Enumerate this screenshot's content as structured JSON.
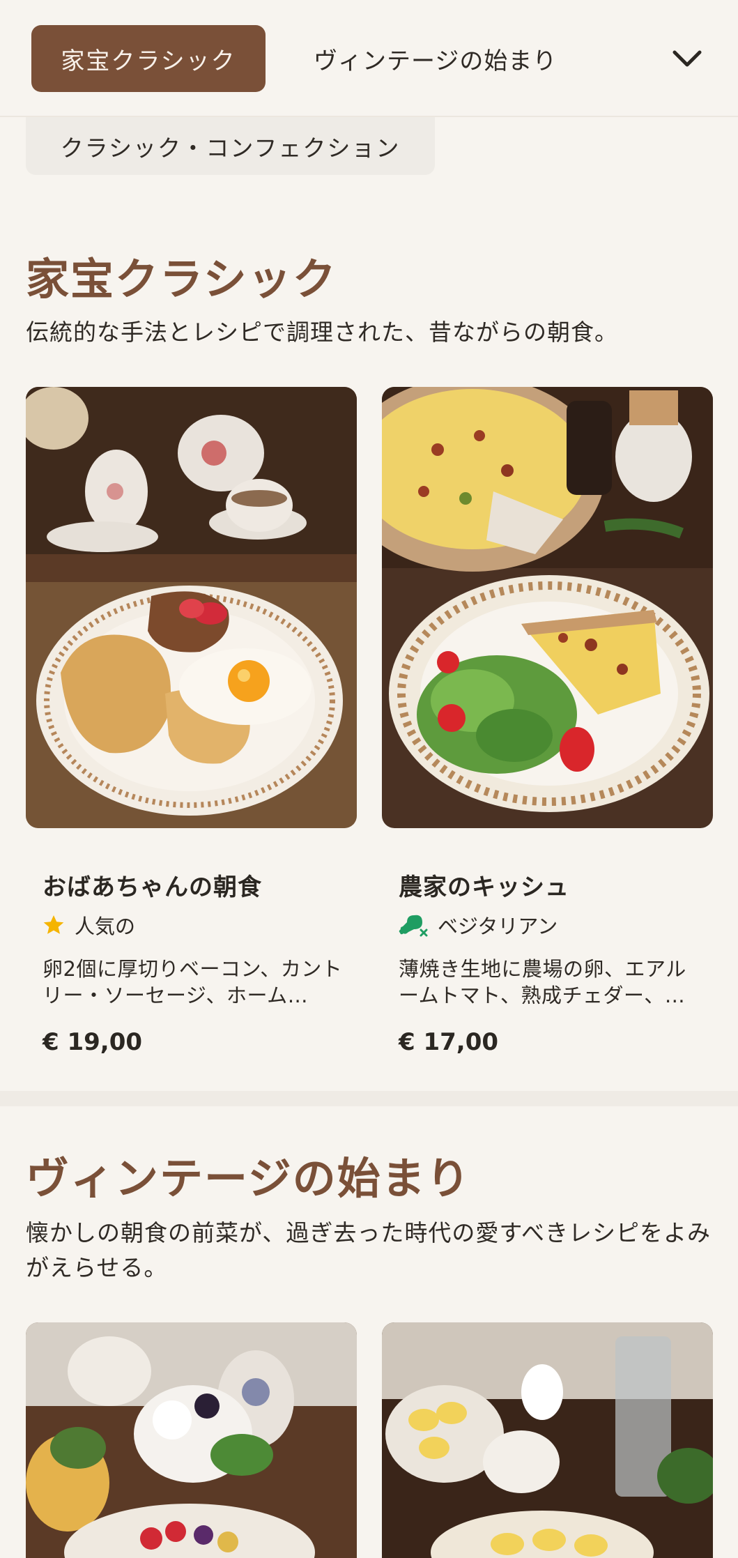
{
  "nav": {
    "tabs": [
      {
        "label": "家宝クラシック",
        "active": true
      },
      {
        "label": "ヴィンテージの始まり",
        "active": false
      },
      {
        "label": "クラシック・コンフェクション",
        "active": false
      }
    ],
    "expand_icon": "chevron-down-icon"
  },
  "sections": [
    {
      "title": "家宝クラシック",
      "description": "伝統的な手法とレシピで調理された、昔ながらの朝食。",
      "items": [
        {
          "name": "おばあちゃんの朝食",
          "tag_icon": "star-icon",
          "tag": "人気の",
          "description": "卵2個に厚切りベーコン、カントリー・ソーセージ、ホーム…",
          "price": "€ 19,00"
        },
        {
          "name": "農家のキッシュ",
          "tag_icon": "vegetarian-drumstick-icon",
          "tag": "ベジタリアン",
          "description": "薄焼き生地に農場の卵、エアルームトマト、熟成チェダー、…",
          "price": "€ 17,00"
        }
      ]
    },
    {
      "title": "ヴィンテージの始まり",
      "description": "懐かしの朝食の前菜が、過ぎ去った時代の愛すべきレシピをよみがえらせる。"
    }
  ],
  "colors": {
    "background": "#f7f4ef",
    "accent": "#7a5038",
    "star": "#f5b400",
    "vegetarian": "#1f9d62"
  }
}
